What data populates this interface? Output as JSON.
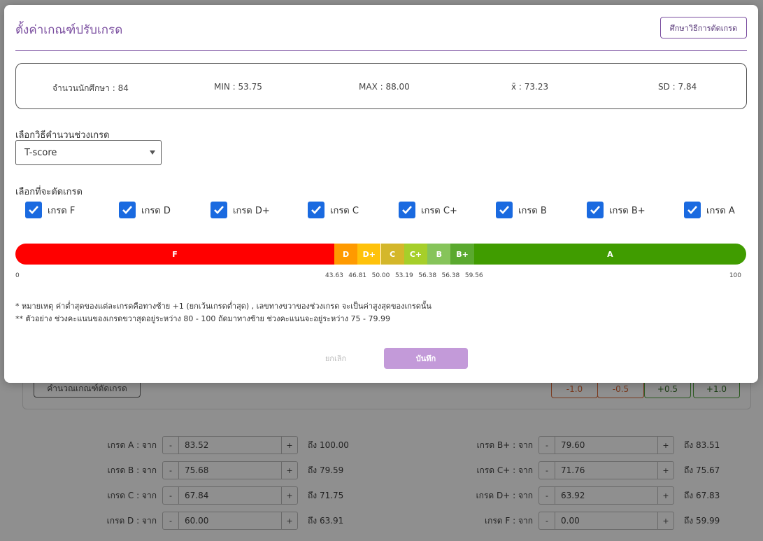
{
  "modal": {
    "title": "ตั้งค่าเกณฑ์ปรับเกรด",
    "study_button": "ศึกษาวิธีการตัดเกรด",
    "stats": {
      "students": "จำนวนนักศึกษา : 84",
      "min": "MIN : 53.75",
      "max": "MAX : 88.00",
      "mean": "x̄ : 73.23",
      "sd": "SD : 7.84"
    },
    "method_label": "เลือกวิธีคำนวนช่วงเกรด",
    "method_value": "T-score",
    "grades_label": "เลือกที่จะตัดเกรด",
    "checkboxes": [
      {
        "label": "เกรด F",
        "checked": true
      },
      {
        "label": "เกรด D",
        "checked": true
      },
      {
        "label": "เกรด D+",
        "checked": true
      },
      {
        "label": "เกรด C",
        "checked": true
      },
      {
        "label": "เกรด C+",
        "checked": true
      },
      {
        "label": "เกรด B",
        "checked": true
      },
      {
        "label": "เกรด B+",
        "checked": true
      },
      {
        "label": "เกรด A",
        "checked": true
      }
    ],
    "grade_bar": {
      "segments": [
        {
          "label": "F",
          "start": 0,
          "end": 43.63,
          "color": "#ff0000"
        },
        {
          "label": "D",
          "start": 43.63,
          "end": 46.81,
          "color": "#ff9a00"
        },
        {
          "label": "D+",
          "start": 46.81,
          "end": 50.0,
          "color": "#ffc20a"
        },
        {
          "label": "C",
          "start": 50.0,
          "end": 53.19,
          "color": "#d4b72a"
        },
        {
          "label": "C+",
          "start": 53.19,
          "end": 56.38,
          "color": "#a6cf2a"
        },
        {
          "label": "B",
          "start": 56.38,
          "end": 59.56,
          "color": "#86c45a"
        },
        {
          "label": "B+",
          "start": 59.56,
          "end": 62.75,
          "color": "#5aa92e"
        },
        {
          "label": "A",
          "start": 62.75,
          "end": 100,
          "color": "#409c00"
        }
      ],
      "ticks": [
        "0",
        "43.63",
        "46.81",
        "50.00",
        "53.19",
        "56.38",
        "56.38",
        "59.56",
        "100"
      ],
      "tick_values": [
        0,
        43.63,
        46.81,
        50.0,
        53.19,
        56.38,
        59.56,
        62.75,
        100
      ]
    },
    "note1": "* หมายเหตุ ค่าต่ำสุดของแต่ละเกรดคือทางซ้าย +1 (ยกเว้นเกรดต่ำสุด) , เลขทางขวาของช่วงเกรด จะเป็นค่าสูงสุดของเกรดนั้น",
    "note2": "** ตัวอย่าง ช่วงคะแนนของเกรดขวาสุดอยู่ระหว่าง 80 - 100 ถัดมาทางซ้าย ช่วงคะแนนจะอยู่ระหว่าง 75 - 79.99",
    "cancel_label": "ยกเลิก",
    "save_label": "บันทึก"
  },
  "background": {
    "calc_button": "คำนวณเกณฑ์ตัดเกรด",
    "adjust": [
      "-1.0",
      "-0.5",
      "+0.5",
      "+1.0"
    ],
    "ranges": [
      {
        "label": "เกรด A : จาก",
        "value": "83.52",
        "to": "ถึง 100.00"
      },
      {
        "label": "เกรด B+ : จาก",
        "value": "79.60",
        "to": "ถึง 83.51"
      },
      {
        "label": "เกรด B : จาก",
        "value": "75.68",
        "to": "ถึง 79.59"
      },
      {
        "label": "เกรด C+ : จาก",
        "value": "71.76",
        "to": "ถึง 75.67"
      },
      {
        "label": "เกรด C : จาก",
        "value": "67.84",
        "to": "ถึง 71.75"
      },
      {
        "label": "เกรด D+ : จาก",
        "value": "63.92",
        "to": "ถึง 67.83"
      },
      {
        "label": "เกรด D : จาก",
        "value": "60.00",
        "to": "ถึง 63.91"
      },
      {
        "label": "เกรด F : จาก",
        "value": "0.00",
        "to": "ถึง 59.99"
      }
    ],
    "stepper_minus": "-",
    "stepper_plus": "+"
  }
}
